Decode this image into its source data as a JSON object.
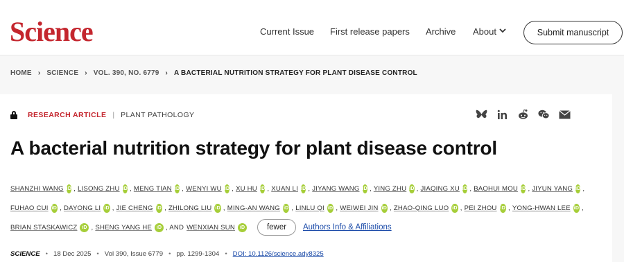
{
  "header": {
    "logo": "Science",
    "nav": {
      "current_issue": "Current Issue",
      "first_release": "First release papers",
      "archive": "Archive",
      "about": "About"
    },
    "submit_label": "Submit manuscript"
  },
  "breadcrumb": {
    "items": [
      "HOME",
      "SCIENCE",
      "VOL. 390, NO. 6779",
      "A BACTERIAL NUTRITION STRATEGY FOR PLANT DISEASE CONTROL"
    ]
  },
  "article": {
    "type": "RESEARCH ARTICLE",
    "subject": "PLANT PATHOLOGY",
    "title": "A bacterial nutrition strategy for plant disease control"
  },
  "share_icons": [
    "bluesky-icon",
    "linkedin-icon",
    "reddit-icon",
    "wechat-icon",
    "email-icon"
  ],
  "authors": {
    "line1": [
      "SHANZHI WANG",
      "LISONG ZHU",
      "MENG TIAN",
      "WENYI WU",
      "XU HU",
      "XUAN LI",
      "JIYANG WANG",
      "YING ZHU",
      "JIAQING XU",
      "BAOHUI MOU",
      "JIYUN YANG"
    ],
    "line2": [
      "FUHAO CUI",
      "DAYONG LI",
      "JIE CHENG",
      "ZHILONG LIU",
      "MING-AN WANG",
      "LINLU QI",
      "WEIWEI JIN",
      "ZHAO-QING LUO",
      "PEI ZHOU",
      "YONG-HWAN LEE"
    ],
    "line3": [
      "BRIAN STASKAWICZ",
      "SHENG YANG HE"
    ],
    "and_label": ", AND",
    "last": "WENXIAN SUN",
    "fewer_label": "fewer",
    "affiliations_label": "Authors Info & Affiliations"
  },
  "citation": {
    "journal": "SCIENCE",
    "date": "18 Dec 2025",
    "volume": "Vol 390, Issue 6779",
    "pages": "pp. 1299-1304",
    "doi": "DOI: 10.1126/science.ady8325"
  }
}
